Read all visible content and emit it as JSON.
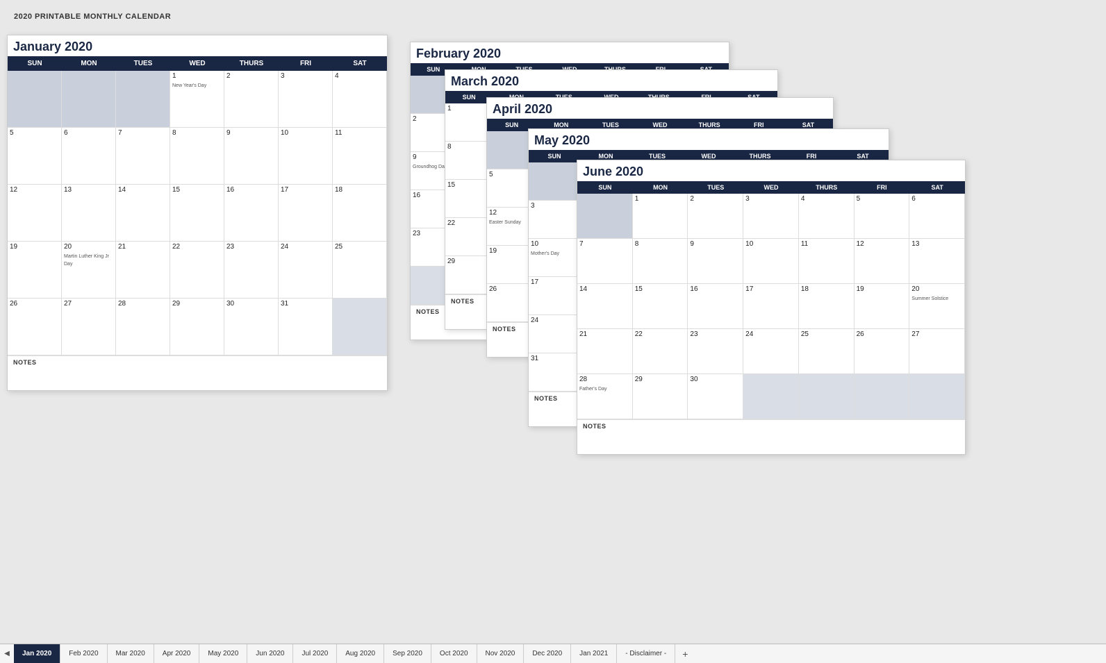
{
  "page": {
    "title": "2020 PRINTABLE MONTHLY CALENDAR"
  },
  "calendars": {
    "january": {
      "title": "January 2020",
      "headers": [
        "SUN",
        "MON",
        "TUES",
        "WED",
        "THURS",
        "FRI",
        "SAT"
      ],
      "weeks": [
        [
          null,
          null,
          null,
          {
            "d": 1
          },
          {
            "d": 2
          },
          {
            "d": 3
          },
          {
            "d": 4,
            "evt": "New Year's Day"
          }
        ],
        [
          {
            "d": 5
          },
          {
            "d": 6
          },
          {
            "d": 7
          },
          {
            "d": 8
          },
          {
            "d": 9
          },
          {
            "d": 10
          },
          {
            "d": 11
          }
        ],
        [
          {
            "d": 12
          },
          {
            "d": 13
          },
          {
            "d": 14
          },
          {
            "d": 15
          },
          {
            "d": 16
          },
          {
            "d": 17
          },
          {
            "d": 18
          }
        ],
        [
          {
            "d": 19
          },
          {
            "d": 20,
            "evt": "Martin Luther King Jr Day"
          },
          {
            "d": 21
          },
          {
            "d": 22
          },
          {
            "d": 23
          },
          {
            "d": 24
          },
          {
            "d": 25
          }
        ],
        [
          {
            "d": 26
          },
          {
            "d": 27
          },
          {
            "d": 28
          },
          {
            "d": 29
          },
          {
            "d": 30
          },
          {
            "d": 31
          },
          null
        ]
      ]
    },
    "february": {
      "title": "February 2020",
      "headers": [
        "SUN",
        "MON",
        "TUES",
        "WED",
        "THURS",
        "FRI",
        "SAT"
      ]
    },
    "march": {
      "title": "March 2020",
      "headers": [
        "SUN",
        "MON",
        "TUES",
        "WED",
        "THURS",
        "FRI",
        "SAT"
      ]
    },
    "april": {
      "title": "April 2020",
      "headers": [
        "SUN",
        "MON",
        "TUES",
        "WED",
        "THURS",
        "FRI",
        "SAT"
      ]
    },
    "may": {
      "title": "May 2020",
      "headers": [
        "SUN",
        "MON",
        "TUES",
        "WED",
        "THURS",
        "FRI",
        "SAT"
      ]
    },
    "june": {
      "title": "June 2020",
      "headers": [
        "SUN",
        "MON",
        "TUES",
        "WED",
        "THURS",
        "FRI",
        "SAT"
      ],
      "weeks": [
        [
          null,
          {
            "d": 1
          },
          {
            "d": 2
          },
          {
            "d": 3
          },
          {
            "d": 4
          },
          {
            "d": 5
          },
          {
            "d": 6
          }
        ],
        [
          {
            "d": 7
          },
          {
            "d": 8
          },
          {
            "d": 9
          },
          {
            "d": 10
          },
          {
            "d": 11
          },
          {
            "d": 12
          },
          {
            "d": 13
          }
        ],
        [
          {
            "d": 14
          },
          {
            "d": 15
          },
          {
            "d": 16
          },
          {
            "d": 17
          },
          {
            "d": 18
          },
          {
            "d": 19
          },
          {
            "d": 20,
            "evt": "Summer Solstice"
          }
        ],
        [
          {
            "d": 21
          },
          {
            "d": 22
          },
          {
            "d": 23
          },
          {
            "d": 24
          },
          {
            "d": 25
          },
          {
            "d": 26
          },
          {
            "d": 27
          }
        ],
        [
          {
            "d": 28,
            "evt": "Father's Day"
          },
          {
            "d": 29
          },
          {
            "d": 30
          },
          null,
          null,
          null,
          null
        ]
      ]
    }
  },
  "tabs": [
    {
      "label": "Jan 2020",
      "active": true
    },
    {
      "label": "Feb 2020"
    },
    {
      "label": "Mar 2020"
    },
    {
      "label": "Apr 2020"
    },
    {
      "label": "May 2020"
    },
    {
      "label": "Jun 2020"
    },
    {
      "label": "Jul 2020"
    },
    {
      "label": "Aug 2020"
    },
    {
      "label": "Sep 2020"
    },
    {
      "label": "Oct 2020"
    },
    {
      "label": "Nov 2020"
    },
    {
      "label": "Dec 2020"
    },
    {
      "label": "Jan 2021"
    },
    {
      "label": "- Disclaimer -"
    }
  ],
  "notes_label": "NOTES"
}
